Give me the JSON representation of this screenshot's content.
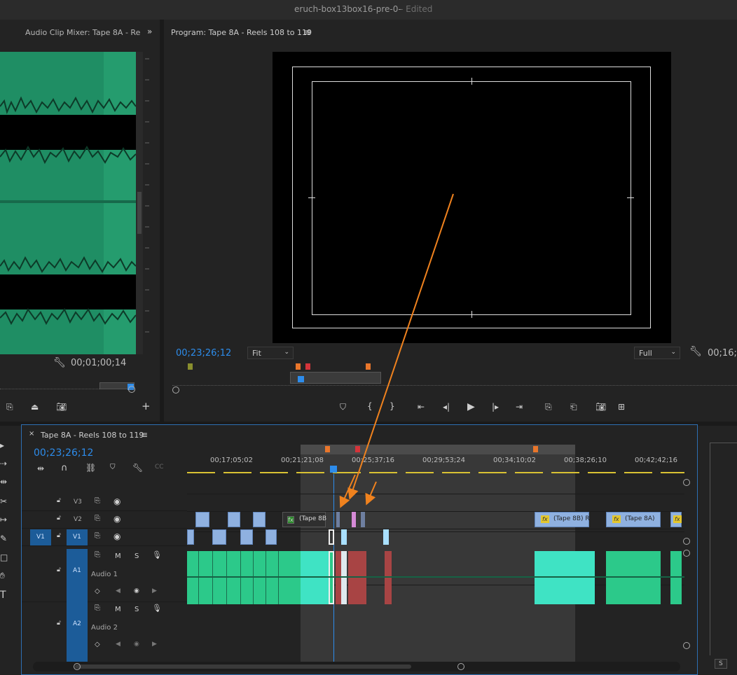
{
  "window": {
    "title": "eruch-box13box16-pre-0-",
    "status": "- Edited"
  },
  "audio_mixer": {
    "tab_label": "Audio Clip Mixer: Tape 8A - Re",
    "timecode": "00;01;00;14"
  },
  "program_monitor": {
    "tab_label": "Program: Tape 8A - Reels 108 to 119",
    "timecode": "00;23;26;12",
    "zoom_select": "Fit",
    "quality_select": "Full",
    "duration": "00;16;"
  },
  "timeline": {
    "tab_label": "Tape 8A - Reels 108 to 119",
    "timecode": "00;23;26;12",
    "ruler_ticks": [
      "00;17;05;02",
      "00;21;21;08",
      "00;25;37;16",
      "00;29;53;24",
      "00;34;10;02",
      "00;38;26;10",
      "00;42;42;16"
    ],
    "tracks": {
      "v3": "V3",
      "v2": "V2",
      "v1": "V1",
      "v1_src": "V1",
      "a1": "A1",
      "a1_name": "Audio 1",
      "a2": "A2",
      "a2_name": "Audio 2"
    },
    "clips": {
      "tape8b_left": "(Tape 8B",
      "tape8b_right": "(Tape 8B) R",
      "tape8a": "(Tape 8A)",
      "fx": "fx"
    },
    "track_buttons": {
      "m": "M",
      "s": "S"
    }
  },
  "right_panel": {
    "s_button": "S"
  },
  "annotation": {
    "arrow_color": "#f0821e"
  },
  "colors": {
    "accent_blue": "#2d8ceb",
    "clip_green": "#2cc98a",
    "clip_cyan": "#3fe3c4",
    "marker_orange": "#e9762b",
    "marker_red": "#d4343a"
  }
}
